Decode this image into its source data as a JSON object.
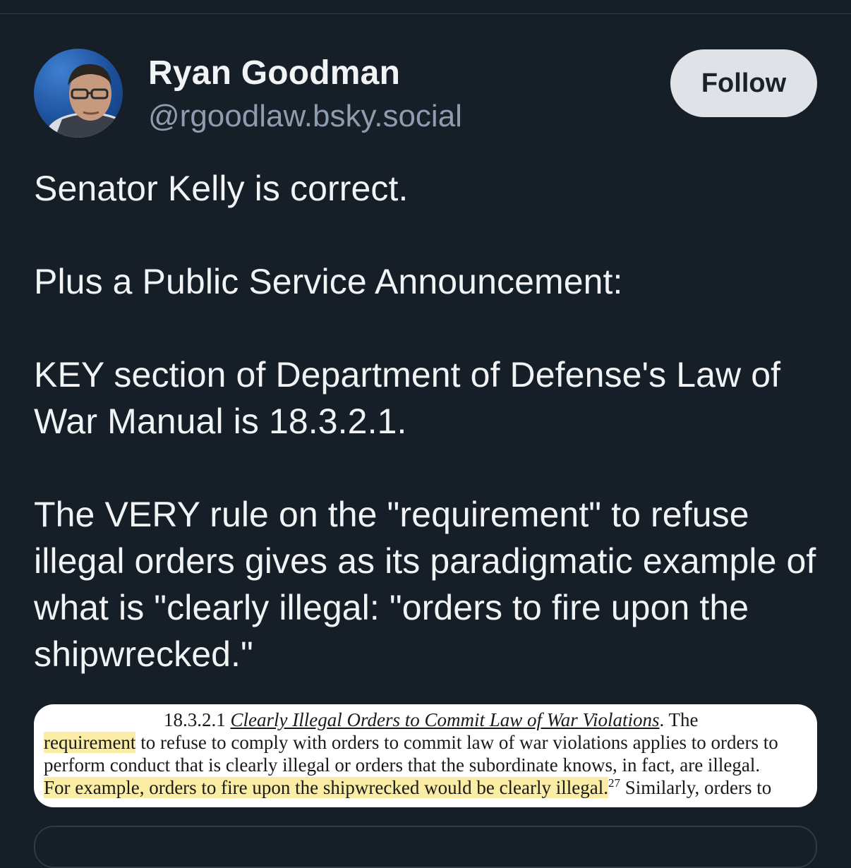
{
  "author": {
    "display_name": "Ryan Goodman",
    "handle": "@rgoodlaw.bsky.social",
    "avatar_icon": "person-photo-icon"
  },
  "follow_button": {
    "label": "Follow"
  },
  "post": {
    "paragraphs": [
      "Senator Kelly is correct.",
      "Plus a Public Service Announcement:",
      "KEY section of Department of Defense's Law of War Manual is 18.3.2.1.",
      "The VERY rule on the \"requirement\" to refuse illegal orders gives as its paradigmatic example of what is \"clearly illegal: \"orders to fire upon the shipwrecked.\""
    ]
  },
  "embedded_image": {
    "heading_number": "18.3.2.1",
    "heading_title": "Clearly Illegal Orders to Commit Law of War Violations",
    "heading_after": ".  The",
    "line1_highlight": "requirement",
    "line1_rest": " to refuse to comply with orders to commit law of war violations applies to orders to",
    "line2": "perform conduct that is clearly illegal or orders that the subordinate knows, in fact, are illegal.",
    "line3_highlight": "For example, orders to fire upon the shipwrecked would be clearly illegal.",
    "line3_footnote": "27",
    "line3_rest": "  Similarly, orders to",
    "highlight_color": "#fbeea4"
  },
  "colors": {
    "background": "#161e27",
    "text_primary": "#f1f3f5",
    "text_secondary": "#8e9caf",
    "follow_bg": "#dfe3e8"
  }
}
